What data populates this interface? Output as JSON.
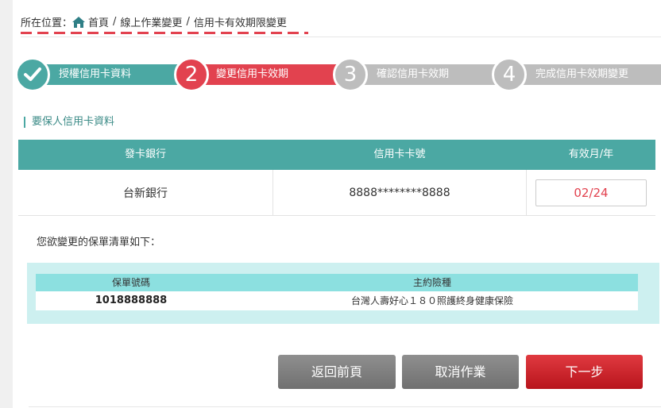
{
  "breadcrumb": {
    "prefix": "所在位置：",
    "items": [
      "首頁",
      "線上作業變更",
      "信用卡有效期限變更"
    ],
    "separator": "/"
  },
  "steps": [
    {
      "number": "",
      "label": "授權信用卡資料",
      "state": "done"
    },
    {
      "number": "2",
      "label": "變更信用卡效期",
      "state": "active"
    },
    {
      "number": "3",
      "label": "確認信用卡效期",
      "state": "pending"
    },
    {
      "number": "4",
      "label": "完成信用卡效期變更",
      "state": "pending"
    }
  ],
  "section_title": "要保人信用卡資料",
  "card_table": {
    "headers": [
      "發卡銀行",
      "信用卡卡號",
      "有效月/年"
    ],
    "row": {
      "bank": "台新銀行",
      "card_number": "8888********8888",
      "expiry": "02/24"
    }
  },
  "policy_note": "您欲變更的保單清單如下：",
  "policy_table": {
    "headers": [
      "保單號碼",
      "主約險種"
    ],
    "rows": [
      {
        "policy_no": "1018888888",
        "product": "台灣人壽好心１８０照護終身健康保險"
      }
    ]
  },
  "buttons": {
    "back": "返回前頁",
    "cancel": "取消作業",
    "next": "下一步"
  },
  "colors": {
    "teal": "#4ba8a3",
    "active_red": "#e2424f",
    "pending_gray": "#bdbdbd",
    "light_cyan": "#cdf0f0",
    "cyan_head": "#8ce0e0"
  }
}
